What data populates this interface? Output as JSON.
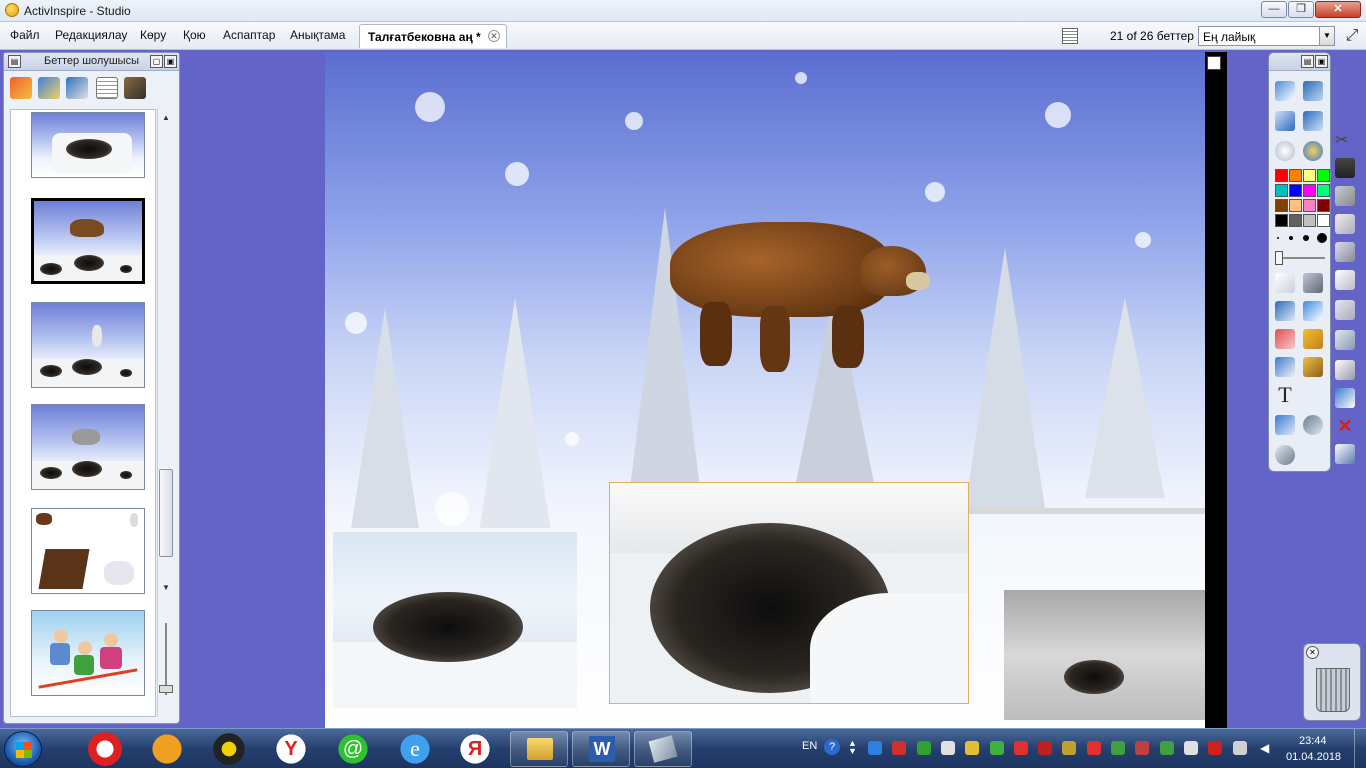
{
  "window": {
    "title": "ActivInspire - Studio",
    "buttons": {
      "minimize": "—",
      "maximize": "❐",
      "close": "✕"
    }
  },
  "menu": {
    "items": [
      "Файл",
      "Редакциялау",
      "Көру",
      "Қою",
      "Аспаптар",
      "Анықтама"
    ]
  },
  "document_tab": {
    "label": "Талғатбековна аң *"
  },
  "page_info": {
    "count_text": "21 of 26 беттер"
  },
  "zoom": {
    "value": "Ең лайық"
  },
  "page_browser": {
    "title": "Беттер шолушысы",
    "tools": [
      "page-tool-icon",
      "page-flip-icon",
      "page-mail-icon",
      "page-list-icon",
      "page-brush-icon"
    ],
    "thumbnails": [
      "snow-cave",
      "bear-and-dens",
      "rabbit-and-dens",
      "wolf-and-dens",
      "bear-rabbit-characters",
      "kids-skiing"
    ],
    "selected_index": 1
  },
  "canvas": {
    "scene": "winter-forest",
    "objects": [
      "bear",
      "den-photo-left",
      "den-photo-center",
      "den-photo-right"
    ]
  },
  "toolbox": {
    "palette": [
      "#ff0000",
      "#ff8000",
      "#ffff80",
      "#00ff00",
      "#00c0c0",
      "#0000ff",
      "#ff00ff",
      "#00ff80",
      "#804000",
      "#ffc080",
      "#ff80c0",
      "#800000",
      "#000000",
      "#606060",
      "#c0c0c0",
      "#ffffff"
    ],
    "tools": [
      "select-icon",
      "pen-icon",
      "highlighter-icon",
      "eraser-icon",
      "fill-icon",
      "connector-icon",
      "text-icon",
      "undo-icon",
      "redo-icon"
    ]
  },
  "taskbar": {
    "apps": [
      "opera-icon",
      "media-player-icon",
      "kmplayer-icon",
      "yandex-icon",
      "mail-icon",
      "ie-icon",
      "yandex-browser-icon"
    ],
    "tasks": [
      "explorer-task",
      "word-task",
      "activinspire-task"
    ],
    "language": "EN",
    "time": "23:44",
    "date": "01.04.2018"
  }
}
